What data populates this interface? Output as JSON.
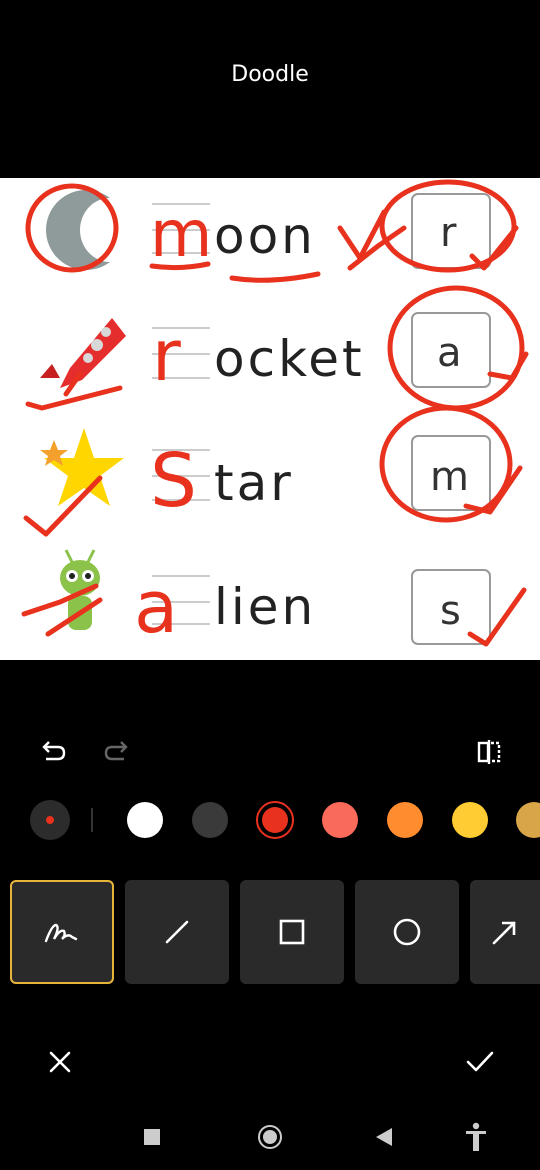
{
  "header": {
    "title": "Doodle"
  },
  "worksheet": {
    "rows": [
      {
        "image": "moon-icon",
        "letter": "m",
        "rest": "oon",
        "box": "r"
      },
      {
        "image": "rocket-icon",
        "letter": "r",
        "rest": "ocket",
        "box": "a"
      },
      {
        "image": "star-icon",
        "letter": "S",
        "rest": "tar",
        "box": "m"
      },
      {
        "image": "alien-icon",
        "letter": "a",
        "rest": "lien",
        "box": "s"
      }
    ],
    "ink_color": "#e8321e"
  },
  "colors": {
    "selected": "#e8321e",
    "swatches": [
      "#ffffff",
      "#3a3a3a",
      "#e8321e",
      "#fa6a5a",
      "#ff8c2e",
      "#ffcc33",
      "#d8a548"
    ]
  },
  "tools": [
    {
      "name": "freehand",
      "icon": "pen-scribble-icon",
      "selected": true
    },
    {
      "name": "line",
      "icon": "line-icon",
      "selected": false
    },
    {
      "name": "rectangle",
      "icon": "square-icon",
      "selected": false
    },
    {
      "name": "ellipse",
      "icon": "circle-icon",
      "selected": false
    },
    {
      "name": "arrow",
      "icon": "arrow-icon",
      "selected": false
    }
  ]
}
